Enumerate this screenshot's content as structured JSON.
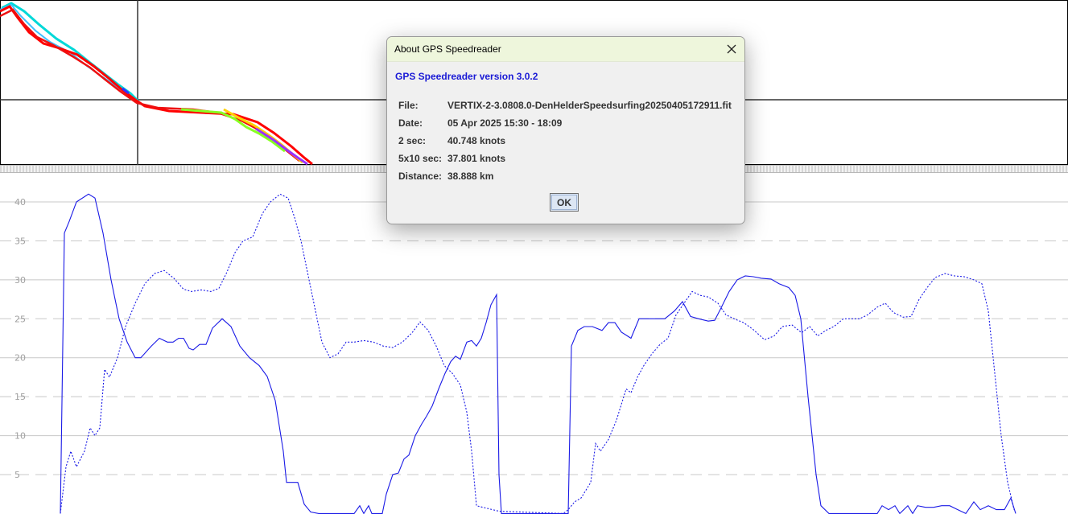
{
  "dialog": {
    "title": "About GPS Speedreader",
    "version": "GPS Speedreader version 3.0.2",
    "rows": [
      {
        "label": "File:",
        "value": "VERTIX-2-3.0808.0-DenHelderSpeedsurfing20250405172911.fit"
      },
      {
        "label": "Date:",
        "value": "05 Apr 2025 15:30 - 18:09"
      },
      {
        "label": "2 sec:",
        "value": "40.748 knots"
      },
      {
        "label": "5x10 sec:",
        "value": "37.801 knots"
      },
      {
        "label": "Distance:",
        "value": "38.888 km"
      }
    ],
    "ok_label": "OK",
    "close_icon": "close-icon"
  },
  "colors": {
    "speed_line": "#1a1ae6",
    "track_red": "#ff0000",
    "grid": "#c8c8c8",
    "dialog_title_bg": "#eef6dc",
    "version_text": "#1a1ad6"
  },
  "chart_data": {
    "type": "line",
    "y_ticks": [
      "40",
      "35",
      "30",
      "25",
      "20",
      "15",
      "10",
      "5"
    ],
    "ylim": [
      0,
      40
    ],
    "grid": true,
    "series": [
      {
        "style": "solid",
        "points": [
          [
            75,
            0
          ],
          [
            80,
            36
          ],
          [
            86,
            37.5
          ],
          [
            95,
            40
          ],
          [
            110,
            41
          ],
          [
            118,
            40.5
          ],
          [
            128,
            36
          ],
          [
            138,
            30
          ],
          [
            148,
            25
          ],
          [
            158,
            22
          ],
          [
            168,
            20
          ],
          [
            175,
            20
          ],
          [
            188,
            21.5
          ],
          [
            198,
            22.5
          ],
          [
            208,
            22
          ],
          [
            215,
            22
          ],
          [
            222,
            22.5
          ],
          [
            228,
            22.5
          ],
          [
            235,
            21.2
          ],
          [
            240,
            21
          ],
          [
            248,
            21.7
          ],
          [
            256,
            21.7
          ],
          [
            264,
            23.8
          ],
          [
            276,
            25
          ],
          [
            287,
            24
          ],
          [
            298,
            21.5
          ],
          [
            310,
            20
          ],
          [
            322,
            19
          ],
          [
            332,
            17.6
          ],
          [
            342,
            14.5
          ],
          [
            352,
            8
          ],
          [
            356,
            4
          ],
          [
            370,
            4
          ],
          [
            378,
            1.2
          ],
          [
            386,
            0.2
          ],
          [
            396,
            0
          ],
          [
            410,
            0
          ],
          [
            420,
            0
          ],
          [
            440,
            0
          ],
          [
            447,
            1
          ],
          [
            452,
            0
          ],
          [
            458,
            1
          ],
          [
            462,
            0
          ],
          [
            475,
            0
          ],
          [
            480,
            2.5
          ],
          [
            488,
            5
          ],
          [
            495,
            5.2
          ],
          [
            502,
            7
          ],
          [
            508,
            7.5
          ],
          [
            516,
            10
          ],
          [
            524,
            11.5
          ],
          [
            530,
            12.5
          ],
          [
            537,
            13.8
          ],
          [
            545,
            16
          ],
          [
            553,
            18
          ],
          [
            560,
            19.5
          ],
          [
            566,
            20.2
          ],
          [
            572,
            19.8
          ],
          [
            580,
            22
          ],
          [
            586,
            22.2
          ],
          [
            592,
            21.5
          ],
          [
            598,
            22.5
          ],
          [
            604,
            24.5
          ],
          [
            610,
            26.8
          ],
          [
            617,
            28.1
          ],
          [
            620,
            5
          ],
          [
            623,
            0
          ],
          [
            700,
            0
          ],
          [
            706,
            0
          ],
          [
            710,
            21.5
          ],
          [
            718,
            23.5
          ],
          [
            726,
            24
          ],
          [
            736,
            24
          ],
          [
            748,
            23.5
          ],
          [
            756,
            24.5
          ],
          [
            764,
            24.5
          ],
          [
            772,
            23.3
          ],
          [
            784,
            22.5
          ],
          [
            794,
            25
          ],
          [
            804,
            25
          ],
          [
            816,
            25
          ],
          [
            826,
            25
          ],
          [
            838,
            26
          ],
          [
            848,
            27.2
          ],
          [
            858,
            25.3
          ],
          [
            868,
            25
          ],
          [
            880,
            24.7
          ],
          [
            888,
            24.8
          ],
          [
            896,
            26.4
          ],
          [
            906,
            28.5
          ],
          [
            916,
            30
          ],
          [
            926,
            30.5
          ],
          [
            936,
            30.4
          ],
          [
            946,
            30.2
          ],
          [
            958,
            30.1
          ],
          [
            968,
            29.5
          ],
          [
            980,
            29
          ],
          [
            988,
            28
          ],
          [
            995,
            25
          ],
          [
            1004,
            15
          ],
          [
            1014,
            5
          ],
          [
            1020,
            1
          ],
          [
            1030,
            0
          ],
          [
            1090,
            0
          ],
          [
            1096,
            1
          ],
          [
            1104,
            0.5
          ],
          [
            1112,
            1
          ],
          [
            1118,
            0
          ],
          [
            1128,
            1
          ],
          [
            1134,
            0
          ],
          [
            1140,
            1
          ],
          [
            1150,
            0.8
          ],
          [
            1160,
            0.8
          ],
          [
            1170,
            1
          ],
          [
            1180,
            1
          ],
          [
            1190,
            0.5
          ],
          [
            1200,
            0
          ],
          [
            1210,
            1.5
          ],
          [
            1218,
            0.5
          ],
          [
            1228,
            1
          ],
          [
            1238,
            0.5
          ],
          [
            1248,
            0.5
          ],
          [
            1256,
            2
          ],
          [
            1262,
            0
          ]
        ]
      },
      {
        "style": "dotted",
        "points": [
          [
            75,
            0
          ],
          [
            82,
            6
          ],
          [
            88,
            8
          ],
          [
            95,
            6
          ],
          [
            105,
            8
          ],
          [
            112,
            11
          ],
          [
            118,
            10
          ],
          [
            124,
            11
          ],
          [
            130,
            18.5
          ],
          [
            136,
            17.5
          ],
          [
            146,
            20
          ],
          [
            156,
            24
          ],
          [
            168,
            27
          ],
          [
            180,
            29.5
          ],
          [
            192,
            30.8
          ],
          [
            204,
            31.2
          ],
          [
            216,
            30.2
          ],
          [
            228,
            28.8
          ],
          [
            238,
            28.5
          ],
          [
            250,
            28.7
          ],
          [
            262,
            28.5
          ],
          [
            272,
            28.9
          ],
          [
            282,
            31
          ],
          [
            292,
            33.5
          ],
          [
            302,
            35
          ],
          [
            314,
            35.5
          ],
          [
            326,
            38.5
          ],
          [
            336,
            40
          ],
          [
            348,
            41
          ],
          [
            358,
            40.5
          ],
          [
            366,
            38
          ],
          [
            374,
            35
          ],
          [
            384,
            30
          ],
          [
            392,
            26
          ],
          [
            400,
            22
          ],
          [
            410,
            20
          ],
          [
            420,
            20.5
          ],
          [
            430,
            22
          ],
          [
            440,
            22
          ],
          [
            452,
            22.2
          ],
          [
            464,
            22
          ],
          [
            476,
            21.5
          ],
          [
            488,
            21.3
          ],
          [
            500,
            22
          ],
          [
            512,
            23.2
          ],
          [
            522,
            24.6
          ],
          [
            532,
            23.5
          ],
          [
            542,
            21.5
          ],
          [
            552,
            19
          ],
          [
            562,
            18
          ],
          [
            572,
            16.5
          ],
          [
            580,
            13
          ],
          [
            586,
            8
          ],
          [
            592,
            1
          ],
          [
            600,
            0.8
          ],
          [
            612,
            0.5
          ],
          [
            620,
            0.3
          ],
          [
            700,
            0
          ],
          [
            706,
            0.5
          ],
          [
            714,
            1.5
          ],
          [
            722,
            2
          ],
          [
            728,
            3
          ],
          [
            734,
            4
          ],
          [
            740,
            9
          ],
          [
            746,
            8
          ],
          [
            756,
            9.5
          ],
          [
            766,
            12
          ],
          [
            778,
            16
          ],
          [
            784,
            15.5
          ],
          [
            792,
            17.5
          ],
          [
            800,
            19
          ],
          [
            810,
            20.5
          ],
          [
            820,
            21.7
          ],
          [
            830,
            22.5
          ],
          [
            840,
            25.5
          ],
          [
            850,
            27
          ],
          [
            860,
            28.5
          ],
          [
            870,
            28
          ],
          [
            880,
            27.8
          ],
          [
            892,
            27
          ],
          [
            902,
            25.5
          ],
          [
            912,
            25
          ],
          [
            924,
            24.5
          ],
          [
            936,
            23.6
          ],
          [
            950,
            22.3
          ],
          [
            962,
            22.8
          ],
          [
            972,
            24
          ],
          [
            984,
            24.2
          ],
          [
            996,
            23.2
          ],
          [
            1006,
            24
          ],
          [
            1016,
            22.8
          ],
          [
            1026,
            23.5
          ],
          [
            1036,
            24
          ],
          [
            1048,
            25
          ],
          [
            1058,
            25
          ],
          [
            1068,
            25
          ],
          [
            1078,
            25.5
          ],
          [
            1090,
            26.5
          ],
          [
            1100,
            27
          ],
          [
            1110,
            25.8
          ],
          [
            1122,
            25.2
          ],
          [
            1132,
            25.3
          ],
          [
            1142,
            27.5
          ],
          [
            1152,
            29
          ],
          [
            1162,
            30.3
          ],
          [
            1174,
            30.8
          ],
          [
            1186,
            30.5
          ],
          [
            1198,
            30.4
          ],
          [
            1210,
            30
          ],
          [
            1220,
            29.5
          ],
          [
            1228,
            26
          ],
          [
            1236,
            18
          ],
          [
            1244,
            10
          ],
          [
            1252,
            4
          ],
          [
            1260,
            0.5
          ]
        ]
      }
    ]
  }
}
